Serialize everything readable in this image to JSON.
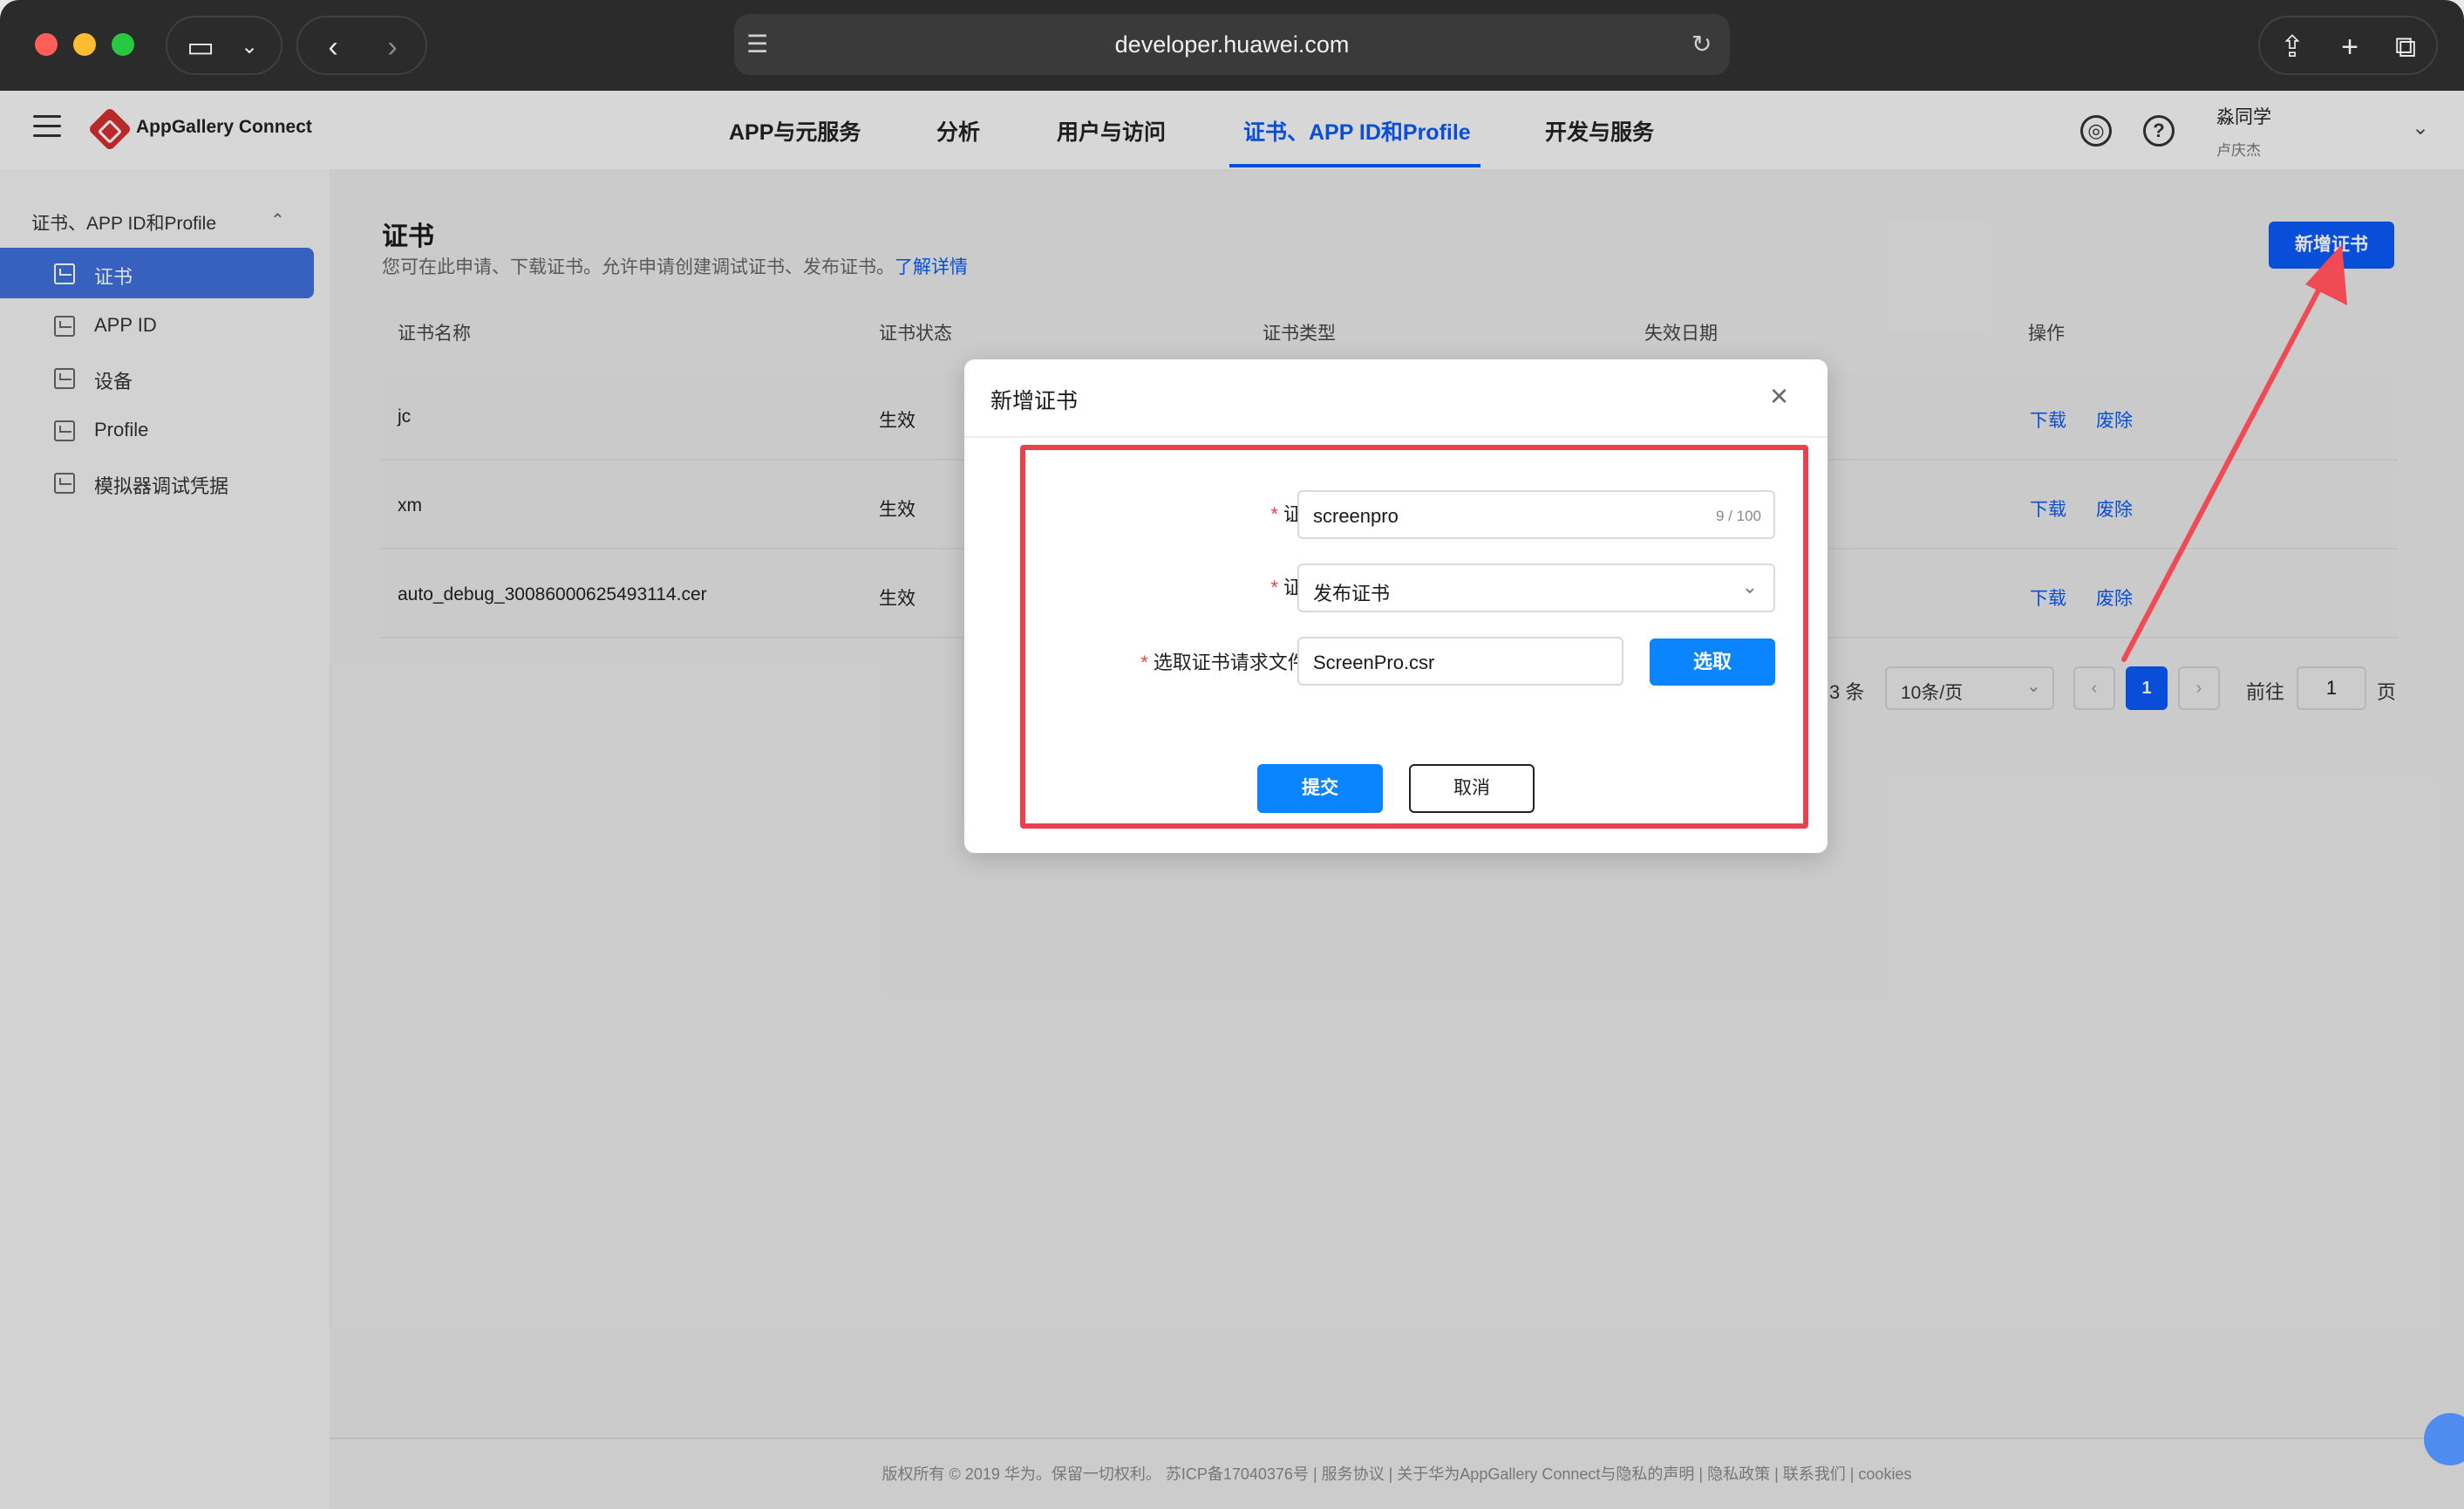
{
  "browser": {
    "url": "developer.huawei.com",
    "icons": [
      "sidebar-toggle-icon",
      "chevron-down-icon",
      "back-icon",
      "forward-icon",
      "site-icon",
      "reload-icon",
      "share-icon",
      "new-tab-icon",
      "tabs-overview-icon"
    ]
  },
  "app": {
    "brand": "AppGallery Connect",
    "nav": [
      "APP与元服务",
      "分析",
      "用户与访问",
      "证书、APP ID和Profile",
      "开发与服务"
    ],
    "active_nav_index": 3,
    "user": {
      "name": "淼同学",
      "sub": "卢庆杰"
    },
    "colors": {
      "accent": "#0a59f7",
      "highlight": "#e8414f"
    }
  },
  "sidebar": {
    "group": "证书、APP ID和Profile",
    "items": [
      {
        "label": "证书",
        "active": true
      },
      {
        "label": "APP ID",
        "active": false
      },
      {
        "label": "设备",
        "active": false
      },
      {
        "label": "Profile",
        "active": false
      },
      {
        "label": "模拟器调试凭据",
        "active": false
      }
    ]
  },
  "page": {
    "title": "证书",
    "desc": "您可在此申请、下载证书。允许申请创建调试证书、发布证书。",
    "learn_more": "了解详情",
    "new_button": "新增证书"
  },
  "table": {
    "headers": [
      "证书名称",
      "证书状态",
      "证书类型",
      "失效日期",
      "操作"
    ],
    "rows": [
      {
        "name": "jc",
        "status": "生效"
      },
      {
        "name": "xm",
        "status": "生效"
      },
      {
        "name": "auto_debug_30086000625493114.cer",
        "status": "生效"
      }
    ],
    "actions": {
      "download": "下载",
      "revoke": "废除"
    }
  },
  "pagination": {
    "total": "3 条",
    "page_size": "10条/页",
    "current": "1",
    "goto_label": "前往",
    "goto_value": "1",
    "page_unit": "页"
  },
  "dialog": {
    "title": "新增证书",
    "name_label": "证书名称:",
    "name_value": "screenpro",
    "name_count": "9 / 100",
    "type_label": "证书类型:",
    "type_value": "发布证书",
    "csr_label": "选取证书请求文件(CSR):",
    "csr_value": "ScreenPro.csr",
    "pick_button": "选取",
    "submit_button": "提交",
    "cancel_button": "取消"
  },
  "footer": "版权所有 © 2019 华为。保留一切权利。 苏ICP备17040376号 | 服务协议 | 关于华为AppGallery Connect与隐私的声明 | 隐私政策 | 联系我们 | cookies"
}
